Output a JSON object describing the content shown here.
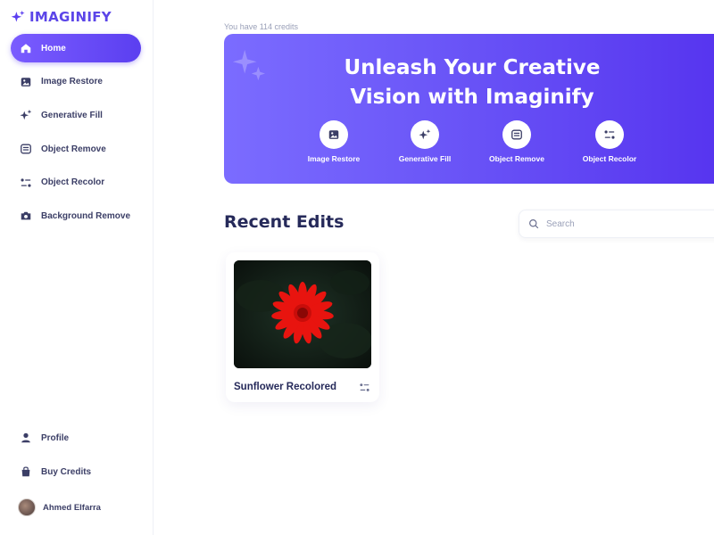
{
  "brand": {
    "name": "IMAGINIFY",
    "accent": "#5b3ff0"
  },
  "sidebar": {
    "items": [
      {
        "label": "Home",
        "icon": "home-icon",
        "active": true
      },
      {
        "label": "Image Restore",
        "icon": "image-icon"
      },
      {
        "label": "Generative Fill",
        "icon": "stars-icon"
      },
      {
        "label": "Object Remove",
        "icon": "scan-icon"
      },
      {
        "label": "Object Recolor",
        "icon": "filter-icon"
      },
      {
        "label": "Background Remove",
        "icon": "camera-icon"
      }
    ],
    "bottom_items": [
      {
        "label": "Profile",
        "icon": "user-icon"
      },
      {
        "label": "Buy Credits",
        "icon": "bag-icon"
      }
    ],
    "user": {
      "name": "Ahmed Elfarra"
    }
  },
  "main": {
    "credits_text": "You have 114 credits",
    "banner": {
      "title_line1": "Unleash Your Creative",
      "title_line2": "Vision with Imaginify",
      "actions": [
        {
          "label": "Image Restore",
          "icon": "image-icon"
        },
        {
          "label": "Generative Fill",
          "icon": "stars-icon"
        },
        {
          "label": "Object Remove",
          "icon": "scan-icon"
        },
        {
          "label": "Object Recolor",
          "icon": "filter-icon"
        }
      ]
    },
    "recent": {
      "title": "Recent Edits",
      "search_placeholder": "Search",
      "items": [
        {
          "title": "Sunflower Recolored",
          "icon": "filter-icon"
        }
      ]
    }
  }
}
